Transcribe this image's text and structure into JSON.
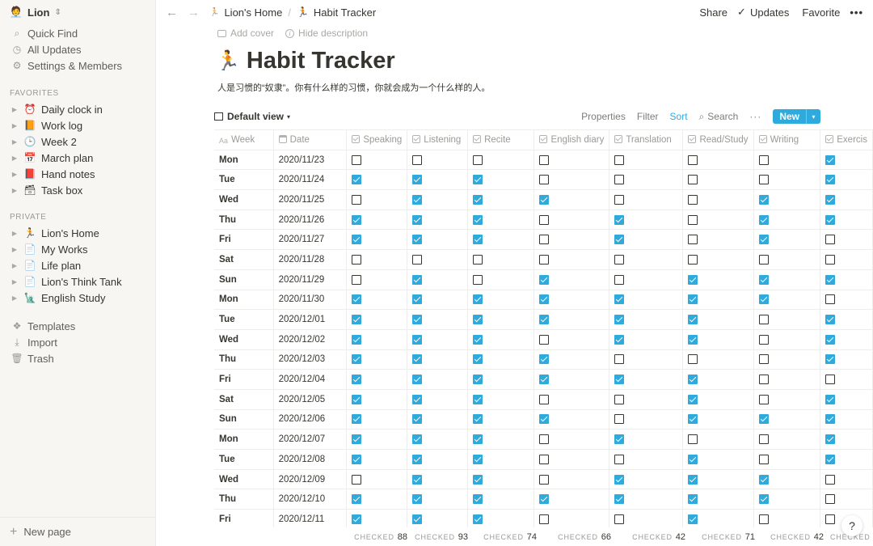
{
  "sidebar": {
    "workspace": {
      "avatar": "🧑‍💼",
      "name": "Lion"
    },
    "top_items": [
      {
        "icon": "search-icon",
        "glyph": "⌕",
        "label": "Quick Find"
      },
      {
        "icon": "clock-icon",
        "glyph": "◷",
        "label": "All Updates"
      },
      {
        "icon": "gear-icon",
        "glyph": "⚙",
        "label": "Settings & Members"
      }
    ],
    "favorites_label": "FAVORITES",
    "favorites": [
      {
        "emoji": "⏰",
        "label": "Daily clock in"
      },
      {
        "emoji": "📙",
        "label": "Work log"
      },
      {
        "emoji": "🕒",
        "label": "Week 2"
      },
      {
        "emoji": "📅",
        "label": "March plan"
      },
      {
        "emoji": "📕",
        "label": "Hand notes"
      },
      {
        "emoji": "🗃",
        "label": "Task box"
      }
    ],
    "private_label": "PRIVATE",
    "private": [
      {
        "emoji": "🏃",
        "label": "Lion's Home"
      },
      {
        "emoji": "📄",
        "label": "My Works"
      },
      {
        "emoji": "📄",
        "label": "Life plan"
      },
      {
        "emoji": "📄",
        "label": "Lion's Think Tank"
      },
      {
        "emoji": "🗽",
        "label": "English Study"
      }
    ],
    "tools": [
      {
        "icon": "templates-icon",
        "glyph": "❖",
        "label": "Templates"
      },
      {
        "icon": "import-icon",
        "glyph": "⤓",
        "label": "Import"
      },
      {
        "icon": "trash-icon",
        "glyph": "🗑",
        "label": "Trash"
      }
    ],
    "new_page": "New page"
  },
  "topbar": {
    "crumb_home_emoji": "🏃",
    "crumb_home": "Lion's Home",
    "crumb_page_emoji": "🏃",
    "crumb_page": "Habit Tracker",
    "share": "Share",
    "updates": "Updates",
    "favorite": "Favorite",
    "more": "•••"
  },
  "page": {
    "add_cover": "Add cover",
    "hide_description": "Hide description",
    "emoji": "🏃",
    "title": "Habit Tracker",
    "description": "人是习惯的“奴隶”。你有什么样的习惯，你就会成为一个什么样的人。"
  },
  "viewbar": {
    "view_name": "Default view",
    "properties": "Properties",
    "filter": "Filter",
    "sort": "Sort",
    "search": "Search",
    "more": "···",
    "new": "New"
  },
  "columns": [
    {
      "key": "week",
      "label": "Week",
      "type": "title"
    },
    {
      "key": "date",
      "label": "Date",
      "type": "date"
    },
    {
      "key": "speaking",
      "label": "Speaking",
      "type": "checkbox"
    },
    {
      "key": "listening",
      "label": "Listening",
      "type": "checkbox"
    },
    {
      "key": "recite",
      "label": "Recite",
      "type": "checkbox"
    },
    {
      "key": "diary",
      "label": "English diary",
      "type": "checkbox"
    },
    {
      "key": "translation",
      "label": "Translation",
      "type": "checkbox"
    },
    {
      "key": "read",
      "label": "Read/Study",
      "type": "checkbox"
    },
    {
      "key": "writing",
      "label": "Writing",
      "type": "checkbox"
    },
    {
      "key": "exercise",
      "label": "Exercis",
      "type": "checkbox"
    }
  ],
  "rows": [
    {
      "week": "Mon",
      "date": "2020/11/23",
      "checks": [
        0,
        0,
        0,
        0,
        0,
        0,
        0,
        1
      ]
    },
    {
      "week": "Tue",
      "date": "2020/11/24",
      "checks": [
        1,
        1,
        1,
        0,
        0,
        0,
        0,
        1
      ]
    },
    {
      "week": "Wed",
      "date": "2020/11/25",
      "checks": [
        0,
        1,
        1,
        1,
        0,
        0,
        1,
        1
      ]
    },
    {
      "week": "Thu",
      "date": "2020/11/26",
      "checks": [
        1,
        1,
        1,
        0,
        1,
        0,
        1,
        1
      ]
    },
    {
      "week": "Fri",
      "date": "2020/11/27",
      "checks": [
        1,
        1,
        1,
        0,
        1,
        0,
        1,
        0
      ]
    },
    {
      "week": "Sat",
      "date": "2020/11/28",
      "checks": [
        0,
        0,
        0,
        0,
        0,
        0,
        0,
        0
      ]
    },
    {
      "week": "Sun",
      "date": "2020/11/29",
      "checks": [
        0,
        1,
        0,
        1,
        0,
        1,
        1,
        1
      ]
    },
    {
      "week": "Mon",
      "date": "2020/11/30",
      "checks": [
        1,
        1,
        1,
        1,
        1,
        1,
        1,
        0
      ]
    },
    {
      "week": "Tue",
      "date": "2020/12/01",
      "checks": [
        1,
        1,
        1,
        1,
        1,
        1,
        0,
        1
      ]
    },
    {
      "week": "Wed",
      "date": "2020/12/02",
      "checks": [
        1,
        1,
        1,
        0,
        1,
        1,
        0,
        1
      ]
    },
    {
      "week": "Thu",
      "date": "2020/12/03",
      "checks": [
        1,
        1,
        1,
        1,
        0,
        0,
        0,
        1
      ]
    },
    {
      "week": "Fri",
      "date": "2020/12/04",
      "checks": [
        1,
        1,
        1,
        1,
        1,
        1,
        0,
        0
      ]
    },
    {
      "week": "Sat",
      "date": "2020/12/05",
      "checks": [
        1,
        1,
        1,
        0,
        0,
        1,
        0,
        1
      ]
    },
    {
      "week": "Sun",
      "date": "2020/12/06",
      "checks": [
        1,
        1,
        1,
        1,
        0,
        1,
        1,
        1
      ]
    },
    {
      "week": "Mon",
      "date": "2020/12/07",
      "checks": [
        1,
        1,
        1,
        0,
        1,
        0,
        0,
        1
      ]
    },
    {
      "week": "Tue",
      "date": "2020/12/08",
      "checks": [
        1,
        1,
        1,
        0,
        0,
        1,
        0,
        1
      ]
    },
    {
      "week": "Wed",
      "date": "2020/12/09",
      "checks": [
        0,
        1,
        1,
        0,
        1,
        1,
        1,
        0
      ]
    },
    {
      "week": "Thu",
      "date": "2020/12/10",
      "checks": [
        1,
        1,
        1,
        1,
        1,
        1,
        1,
        0
      ]
    },
    {
      "week": "Fri",
      "date": "2020/12/11",
      "checks": [
        1,
        1,
        1,
        0,
        0,
        1,
        0,
        0
      ]
    }
  ],
  "footer": {
    "label": "CHECKED",
    "counts": [
      "88",
      "93",
      "74",
      "66",
      "42",
      "71",
      "42",
      ""
    ]
  },
  "help": "?"
}
